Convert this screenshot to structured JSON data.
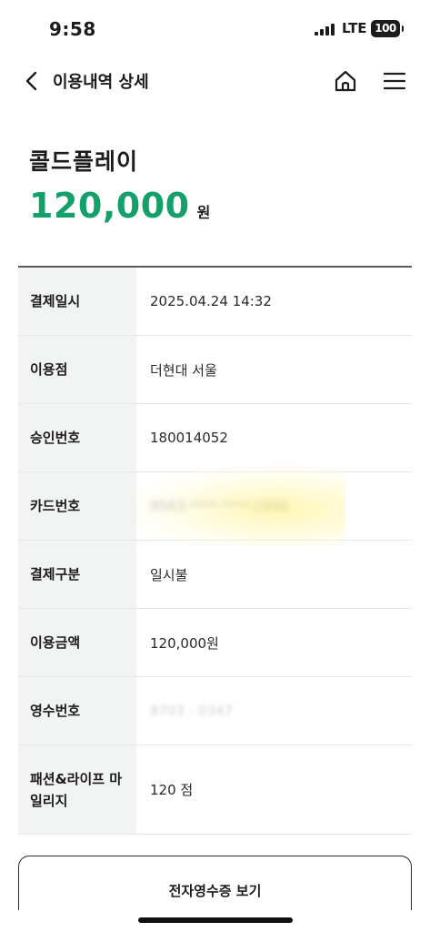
{
  "status_bar": {
    "time": "9:58",
    "network": "LTE",
    "battery": "100"
  },
  "nav": {
    "title": "이용내역 상세"
  },
  "header": {
    "merchant": "콜드플레이",
    "amount": "120,000",
    "amount_unit": "원"
  },
  "details": [
    {
      "label": "결제일시",
      "value": "2025.04.24 14:32"
    },
    {
      "label": "이용점",
      "value": "더현대 서울"
    },
    {
      "label": "승인번호",
      "value": "180014052"
    },
    {
      "label": "카드번호",
      "value": "9583-****-****-2896"
    },
    {
      "label": "결제구분",
      "value": "일시불"
    },
    {
      "label": "이용금액",
      "value": "120,000원"
    },
    {
      "label": "영수번호",
      "value": "8703 - 0347"
    },
    {
      "label": "패션&라이프 마일리지",
      "value": "120 점"
    }
  ],
  "actions": {
    "receipt_label": "전자영수증 보기"
  }
}
